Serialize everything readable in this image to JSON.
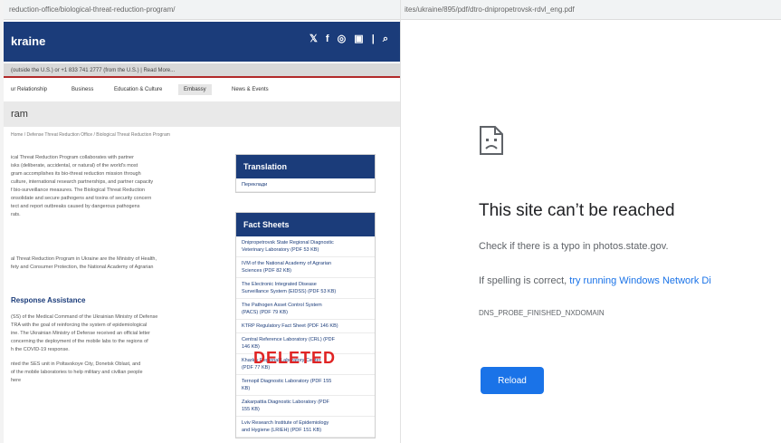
{
  "left": {
    "url": "reduction-office/biological-threat-reduction-program/",
    "site_name": "kraine",
    "social_icons": "𝕏 f ◎ ▣ | ⌕",
    "phone_bar": "(outside the U.S.) or +1 833 741 2777 (from the U.S.) | Read More...",
    "nav": [
      "ur Relationship",
      "Business",
      "Education & Culture",
      "Embassy",
      "News & Events"
    ],
    "page_title": "ram",
    "breadcrumb": "Home / Defense Threat Reduction Office / Biological Threat Reduction Program",
    "paragraph1": "ical Threat Reduction Program collaborates with partner\nisks (deliberate, accidental, or natural) of the world's most\ngram accomplishes its bio-threat reduction mission through\nculture, international research partnerships, and partner capacity\nf bio-surveillance measures. The Biological Threat Reduction\nonsolidate and secure pathogens and toxins of security concern\ntect and report outbreaks caused by dangerous pathogens\nrats.",
    "paragraph2": "al Threat Reduction Program in Ukraine are the Ministry of Health,\nfety and Consumer Protection, the National Academy of Agrarian",
    "heading": "Response Assistance",
    "paragraph3": "(SS) of the Medical Command of the Ukrainian Ministry of Defense\nTRA with the goal of reinforcing the system of epidemiological\nine. The Ukrainian Ministry of Defense received an official letter\nconcerning the deployment of the mobile labs to the regions of\nh the COVID-19 response.",
    "paragraph4": "nted the SES unit in Poltavskoye City, Donetsk Oblast, and\nof the mobile laboratories to help military and civilian people\nhere",
    "translation_head": "Translation",
    "translation_link": "Переклади",
    "factsheets_head": "Fact Sheets",
    "fact_links": [
      "Dnipropetrovsk State Regional Diagnostic\nVeterinary Laboratory (PDF 53 KB)",
      "IVM of the National Academy of Agrarian\nSciences (PDF 82 KB)",
      "The Electronic Integrated Disease\nSurveillance System (EIDSS) (PDF 53 KB)",
      "The Pathogen Asset Control System\n(PACS) (PDF 79 KB)",
      "KTRP Regulatory Fact Sheet (PDF 146 KB)",
      "Central Reference Laboratory (CRL) (PDF\n146 KB)",
      "Kharkiv Regional Laboratory Center\n(PDF 77 KB)",
      "Ternopil Diagnostic Laboratory (PDF 155\nKB)",
      "Zakarpattia Diagnostic Laboratory (PDF\n155 KB)",
      "Lviv Research Institute of Epidemiology\nand Hygiene (LRIEH) (PDF 151 KB)"
    ],
    "overlay_label": "DELETED"
  },
  "right": {
    "url": "ites/ukraine/895/pdf/dtro-dnipropetrovsk-rdvl_eng.pdf",
    "error_icon": "sad-page-icon",
    "title": "This site can’t be reached",
    "line1": "Check if there is a typo in photos.state.gov.",
    "line2_prefix": "If spelling is correct, ",
    "line2_link": "try running Windows Network Di",
    "error_code": "DNS_PROBE_FINISHED_NXDOMAIN",
    "reload_label": "Reload"
  }
}
